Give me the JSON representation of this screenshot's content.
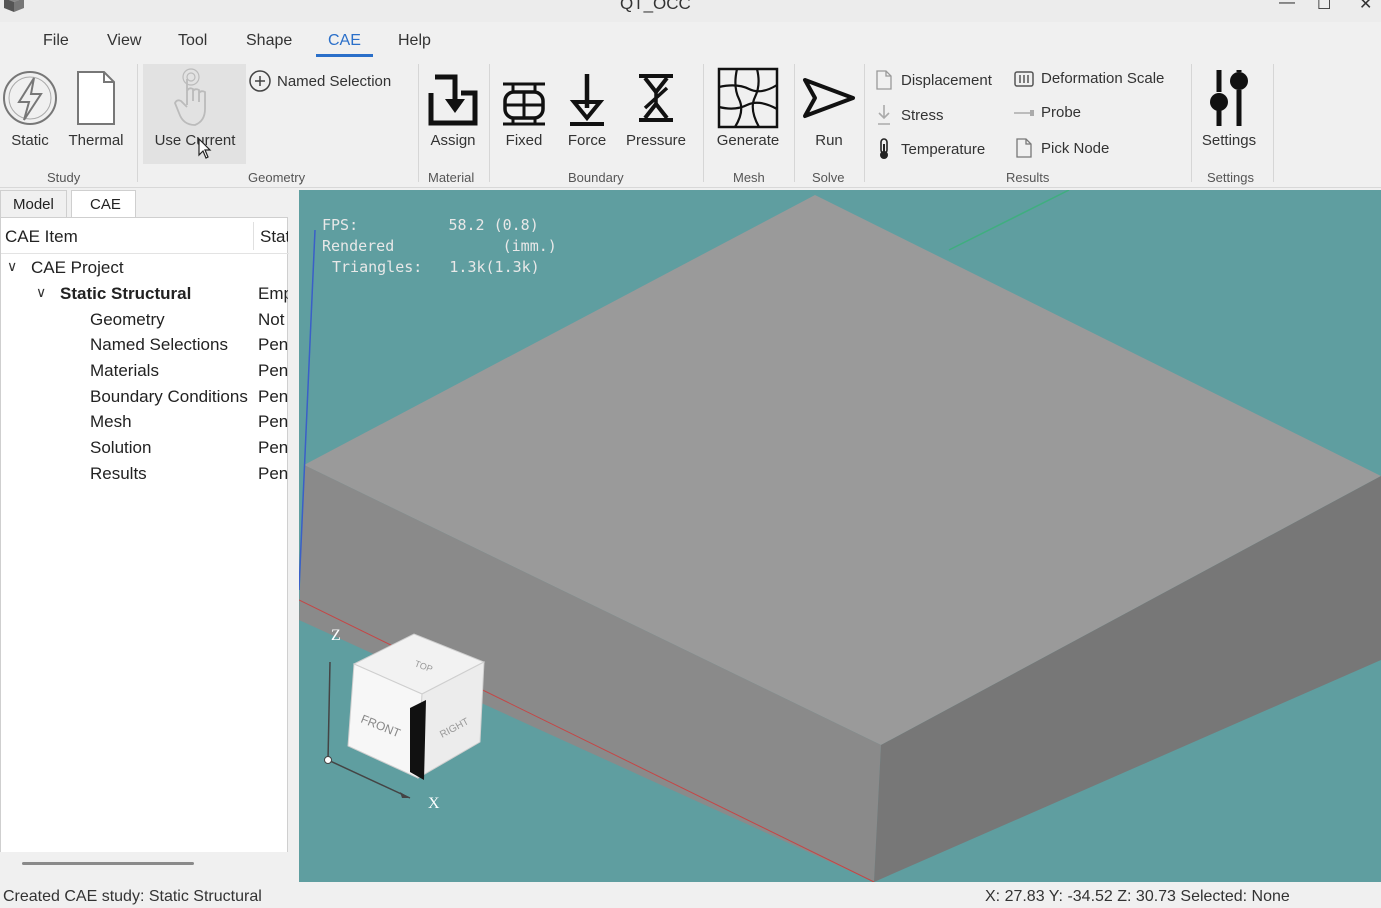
{
  "window": {
    "title": "QT_OCC",
    "minimize_glyph": "—",
    "maximize_glyph": "☐",
    "close_glyph": "✕"
  },
  "menu": {
    "items": [
      "File",
      "View",
      "Tool",
      "Shape",
      "CAE",
      "Help"
    ],
    "active": "CAE"
  },
  "ribbon": {
    "groups": {
      "study": "Study",
      "geometry": "Geometry",
      "material": "Material",
      "boundary": "Boundary",
      "mesh": "Mesh",
      "solve": "Solve",
      "results": "Results",
      "settings": "Settings"
    },
    "buttons": {
      "static": "Static",
      "thermal": "Thermal",
      "use_current": "Use Current",
      "named_selection": "Named Selection",
      "assign": "Assign",
      "fixed": "Fixed",
      "force": "Force",
      "pressure": "Pressure",
      "generate": "Generate",
      "run": "Run",
      "displacement": "Displacement",
      "deformation_scale": "Deformation Scale",
      "stress": "Stress",
      "probe": "Probe",
      "temperature": "Temperature",
      "pick_node": "Pick Node",
      "settings": "Settings"
    }
  },
  "left_panel": {
    "tabs": [
      "Model",
      "CAE"
    ],
    "active_tab": "CAE",
    "columns": {
      "item": "CAE Item",
      "status": "Status"
    },
    "tree": {
      "root": "CAE Project",
      "study": {
        "name": "Static Structural",
        "status": "Empty"
      },
      "children": [
        {
          "name": "Geometry",
          "status": "Not"
        },
        {
          "name": "Named Selections",
          "status": "Pending"
        },
        {
          "name": "Materials",
          "status": "Pending"
        },
        {
          "name": "Boundary Conditions",
          "status": "Pending"
        },
        {
          "name": "Mesh",
          "status": "Pending"
        },
        {
          "name": "Solution",
          "status": "Pending"
        },
        {
          "name": "Results",
          "status": "Pending"
        }
      ]
    }
  },
  "viewport": {
    "background": "#5f9ea0",
    "stats": {
      "fps_label": "FPS:",
      "fps_value": "58.2 (0.8)",
      "rendered_label": "Rendered",
      "rendered_value": "(imm.)",
      "triangles_label": "Triangles:",
      "triangles_value": "1.3k(1.3k)"
    },
    "view_cube": {
      "top": "TOP",
      "front": "FRONT",
      "right": "RIGHT"
    },
    "axes": {
      "z": "Z",
      "x": "X"
    }
  },
  "status": {
    "message": "Created CAE study: Static Structural",
    "coords": "X: 27.83 Y: -34.52 Z: 30.73 Selected: None"
  }
}
